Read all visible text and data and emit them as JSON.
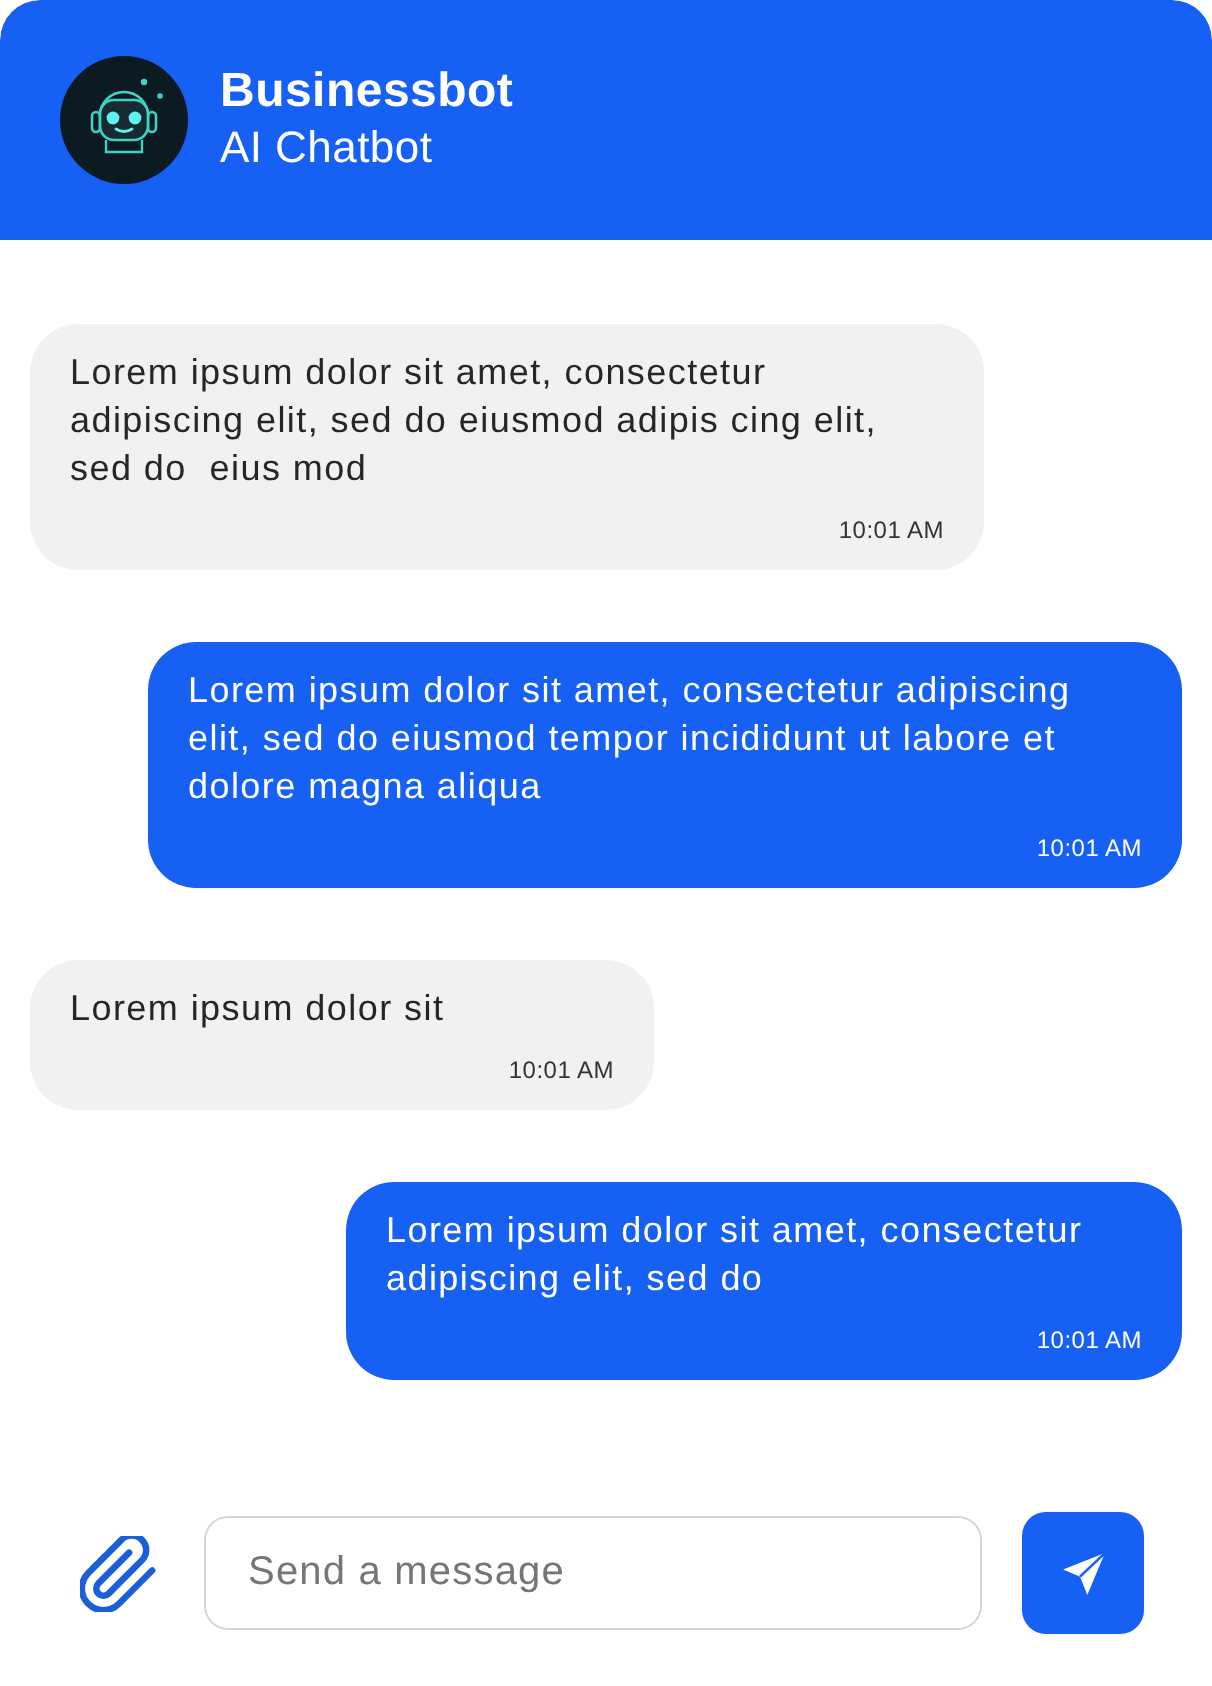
{
  "header": {
    "title": "Businessbot",
    "subtitle": "AI Chatbot"
  },
  "messages": [
    {
      "kind": "received",
      "text": "Lorem ipsum dolor sit amet, consectetur adipiscing elit, sed do eiusmod adipis cing elit, sed do  eius mod",
      "time": "10:01 AM"
    },
    {
      "kind": "sent",
      "text": "Lorem ipsum dolor sit amet, consectetur adipiscing elit, sed do eiusmod tempor incididunt ut labore et dolore magna aliqua",
      "time": "10:01 AM"
    },
    {
      "kind": "received",
      "text": "Lorem ipsum dolor sit",
      "time": "10:01 AM"
    },
    {
      "kind": "sent",
      "text": "Lorem ipsum dolor sit amet, consectetur adipiscing elit, sed do",
      "time": "10:01 AM"
    }
  ],
  "composer": {
    "placeholder": "Send a message"
  }
}
